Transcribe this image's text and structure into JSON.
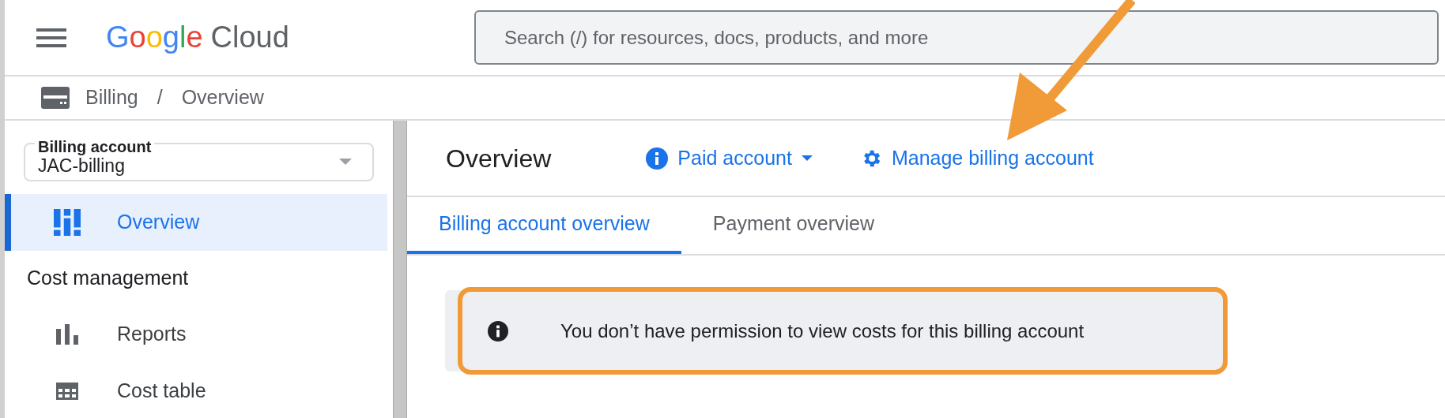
{
  "topbar": {
    "logo": {
      "brand": "Google",
      "product": "Cloud"
    },
    "search": {
      "placeholder": "Search (/) for resources, docs, products, and more"
    }
  },
  "breadcrumb": [
    "Billing",
    "/",
    "Overview"
  ],
  "sidebar": {
    "account_select": {
      "label": "Billing account",
      "value": "JAC-billing"
    },
    "items": [
      {
        "kind": "item",
        "label": "Overview",
        "selected": true
      },
      {
        "kind": "section",
        "label": "Cost management"
      },
      {
        "kind": "item",
        "label": "Reports",
        "selected": false
      },
      {
        "kind": "item",
        "label": "Cost table",
        "selected": false
      }
    ]
  },
  "page": {
    "title": "Overview",
    "status": "Paid account",
    "action": "Manage billing account",
    "tabs": [
      {
        "label": "Billing account overview",
        "selected": true
      },
      {
        "label": "Payment overview",
        "selected": false
      }
    ],
    "notice": {
      "text": "You don’t have permission to view costs for this billing account",
      "highlighted": true
    }
  },
  "callout_arrow": true
}
